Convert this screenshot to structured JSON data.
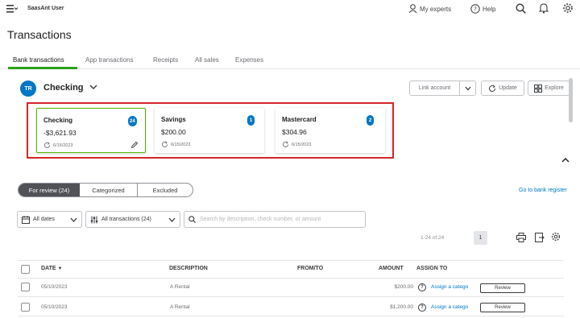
{
  "topbar": {
    "user_name": "SaasAnt User",
    "my_experts": "My experts",
    "help": "Help"
  },
  "page_title": "Transactions",
  "tabs": [
    {
      "label": "Bank transactions",
      "active": true
    },
    {
      "label": "App transactions",
      "active": false
    },
    {
      "label": "Receipts",
      "active": false
    },
    {
      "label": "All sales",
      "active": false
    },
    {
      "label": "Expenses",
      "active": false
    }
  ],
  "account": {
    "icon_label": "TR",
    "title": "Checking"
  },
  "header_buttons": {
    "link_account": "Link account",
    "update": "Update",
    "explore": "Explore"
  },
  "cards": [
    {
      "name": "Checking",
      "balance": "-$3,621.93",
      "badge": "24",
      "date": "6/15/2023",
      "selected": true
    },
    {
      "name": "Savings",
      "balance": "$200.00",
      "badge": "1",
      "date": "6/15/2023",
      "selected": false
    },
    {
      "name": "Mastercard",
      "balance": "$304.96",
      "badge": "2",
      "date": "6/15/2023",
      "selected": false
    }
  ],
  "segments": {
    "for_review": "For review (24)",
    "categorized": "Categorized",
    "excluded": "Excluded"
  },
  "goto_bank_register": "Go to bank register",
  "filters": {
    "dates": "All dates",
    "transactions": "All transactions (24)",
    "search_placeholder": "Search by description, check number, or amount"
  },
  "pager": {
    "range": "1-24 of 24",
    "page": "1"
  },
  "table": {
    "headers": {
      "date": "DATE",
      "description": "DESCRIPTION",
      "from_to": "FROM/TO",
      "amount": "AMOUNT",
      "assign_to": "ASSIGN TO"
    },
    "rows": [
      {
        "date": "05/10/2023",
        "description": "A Rental",
        "amount": "$200.00",
        "assign": "Assign a catego",
        "action": "Review"
      },
      {
        "date": "05/10/2023",
        "description": "A Rental",
        "amount": "$1,200.00",
        "assign": "Assign a catego",
        "action": "Review"
      }
    ]
  },
  "colors": {
    "brand_green": "#2ca01c",
    "link_blue": "#0077c5",
    "highlight_red": "#d5252b"
  }
}
